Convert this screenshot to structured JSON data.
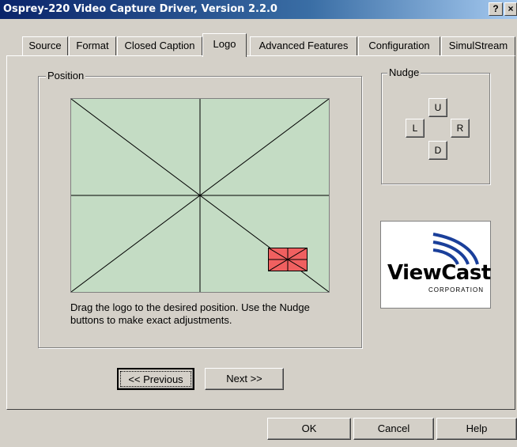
{
  "window": {
    "title": "Osprey-220 Video Capture Driver, Version 2.2.0",
    "help_btn": "?",
    "close_btn": "×"
  },
  "tabs": [
    {
      "label": "Source"
    },
    {
      "label": "Format"
    },
    {
      "label": "Closed Caption"
    },
    {
      "label": "Logo"
    },
    {
      "label": "Advanced Features"
    },
    {
      "label": "Configuration"
    },
    {
      "label": "SimulStream"
    }
  ],
  "active_tab": "Logo",
  "position": {
    "label": "Position",
    "instructions_line1": "Drag the logo to the desired position.  Use the Nudge",
    "instructions_line2": "buttons to make exact adjustments."
  },
  "nudge": {
    "label": "Nudge",
    "up": "U",
    "left": "L",
    "right": "R",
    "down": "D"
  },
  "logo": {
    "name": "ViewCast",
    "sub": "CORPORATION"
  },
  "nav": {
    "previous": "<< Previous",
    "next": "Next >>"
  },
  "footer": {
    "ok": "OK",
    "cancel": "Cancel",
    "help": "Help"
  },
  "colors": {
    "canvas_bg": "#c4dcc4",
    "logo_marker": "#f06060",
    "brand_blue": "#1a3f9a"
  }
}
